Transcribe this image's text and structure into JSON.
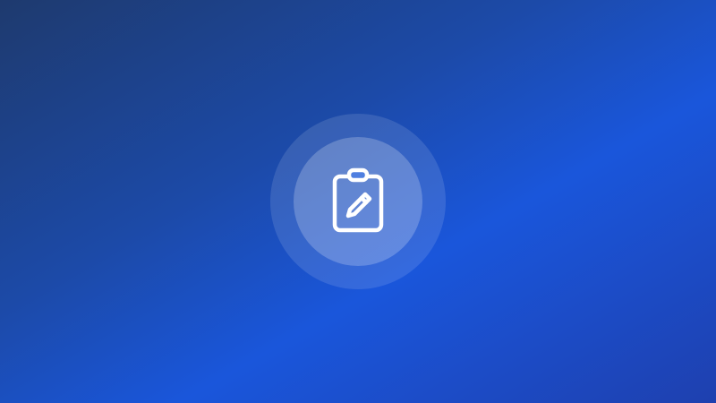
{
  "screen": {
    "background_gradient": [
      "#1e3a6e",
      "#1c4aa8",
      "#1a56db",
      "#1e40af"
    ],
    "icon": "clipboard-edit-icon",
    "icon_color": "#ffffff"
  }
}
